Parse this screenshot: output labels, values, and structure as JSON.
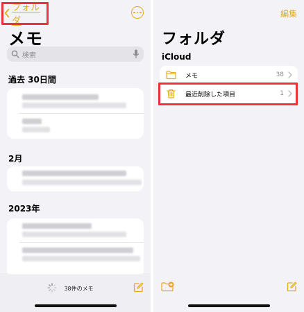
{
  "left": {
    "back_label": "フォルダ",
    "title": "メモ",
    "search_placeholder": "検索",
    "sections": [
      "過去 30日間",
      "2月",
      "2023年"
    ],
    "note_count": "38件のメモ"
  },
  "right": {
    "edit_label": "編集",
    "title": "フォルダ",
    "account": "iCloud",
    "folders": [
      {
        "name": "メモ",
        "count": "38",
        "icon": "folder-icon"
      },
      {
        "name": "最近削除した項目",
        "count": "1",
        "icon": "trash-icon"
      }
    ]
  },
  "colors": {
    "accent": "#e4ab1d",
    "highlight": "#e8323e",
    "background": "#f2f2f7"
  }
}
